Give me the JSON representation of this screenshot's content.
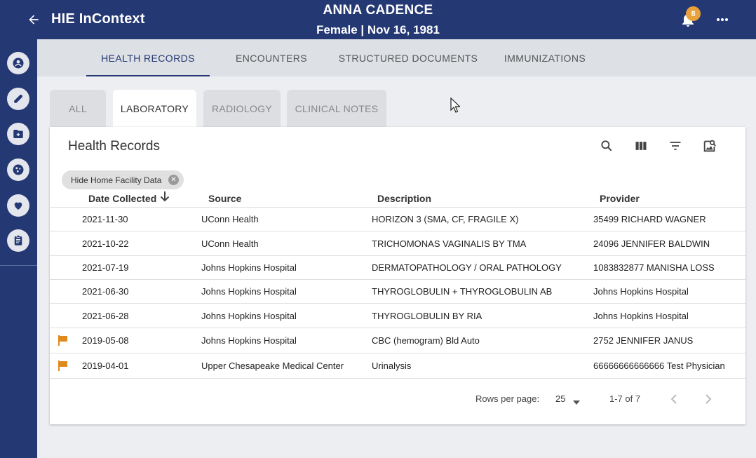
{
  "header": {
    "app_title": "HIE InContext",
    "patient_name": "ANNA CADENCE",
    "patient_info": "Female | Nov 16, 1981",
    "notification_count": "8",
    "icons": {
      "back": "arrow-left-icon",
      "bell": "bell-icon",
      "more": "more-horizontal-icon"
    }
  },
  "sidebar": {
    "items": [
      {
        "icon": "person-icon"
      },
      {
        "icon": "pill-icon"
      },
      {
        "icon": "folder-add-icon"
      },
      {
        "icon": "virus-icon"
      },
      {
        "icon": "heart-hand-icon"
      },
      {
        "icon": "clipboard-icon"
      }
    ]
  },
  "nav": {
    "tabs": [
      {
        "label": "HEALTH RECORDS",
        "active": true
      },
      {
        "label": "ENCOUNTERS"
      },
      {
        "label": "STRUCTURED DOCUMENTS"
      },
      {
        "label": "IMMUNIZATIONS"
      }
    ]
  },
  "subtabs": [
    {
      "label": "ALL"
    },
    {
      "label": "LABORATORY",
      "active": true
    },
    {
      "label": "RADIOLOGY"
    },
    {
      "label": "CLINICAL NOTES"
    }
  ],
  "table": {
    "title": "Health Records",
    "tools": [
      "search-icon",
      "columns-icon",
      "filter-icon",
      "image-search-icon"
    ],
    "filter_chip": "Hide Home Facility Data",
    "columns": [
      "Date Collected",
      "Source",
      "Description",
      "Provider"
    ],
    "rows": [
      {
        "flag": false,
        "date": "2021-11-30",
        "source": "UConn Health",
        "description": "HORIZON 3 (SMA, CF, FRAGILE X)",
        "provider": "35499 RICHARD WAGNER"
      },
      {
        "flag": false,
        "date": "2021-10-22",
        "source": "UConn Health",
        "description": "TRICHOMONAS VAGINALIS BY TMA",
        "provider": "24096 JENNIFER BALDWIN"
      },
      {
        "flag": false,
        "date": "2021-07-19",
        "source": "Johns Hopkins Hospital",
        "description": "DERMATOPATHOLOGY / ORAL PATHOLOGY",
        "provider": "1083832877 MANISHA LOSS"
      },
      {
        "flag": false,
        "date": "2021-06-30",
        "source": "Johns Hopkins Hospital",
        "description": "THYROGLOBULIN + THYROGLOBULIN AB",
        "provider": "Johns Hopkins Hospital"
      },
      {
        "flag": false,
        "date": "2021-06-28",
        "source": "Johns Hopkins Hospital",
        "description": "THYROGLOBULIN BY RIA",
        "provider": "Johns Hopkins Hospital"
      },
      {
        "flag": true,
        "date": "2019-05-08",
        "source": "Johns Hopkins Hospital",
        "description": "CBC (hemogram) Bld Auto",
        "provider": "2752 JENNIFER JANUS"
      },
      {
        "flag": true,
        "date": "2019-04-01",
        "source": "Upper Chesapeake Medical Center",
        "description": "Urinalysis",
        "provider": "66666666666666 Test Physician"
      }
    ],
    "footer": {
      "rows_per_page_label": "Rows per page:",
      "rows_per_page": "25",
      "range": "1-7 of 7"
    }
  },
  "colors": {
    "primary": "#243874",
    "badge": "#e9a13a",
    "flag": "#e08a1e",
    "background": "#eceef1"
  }
}
